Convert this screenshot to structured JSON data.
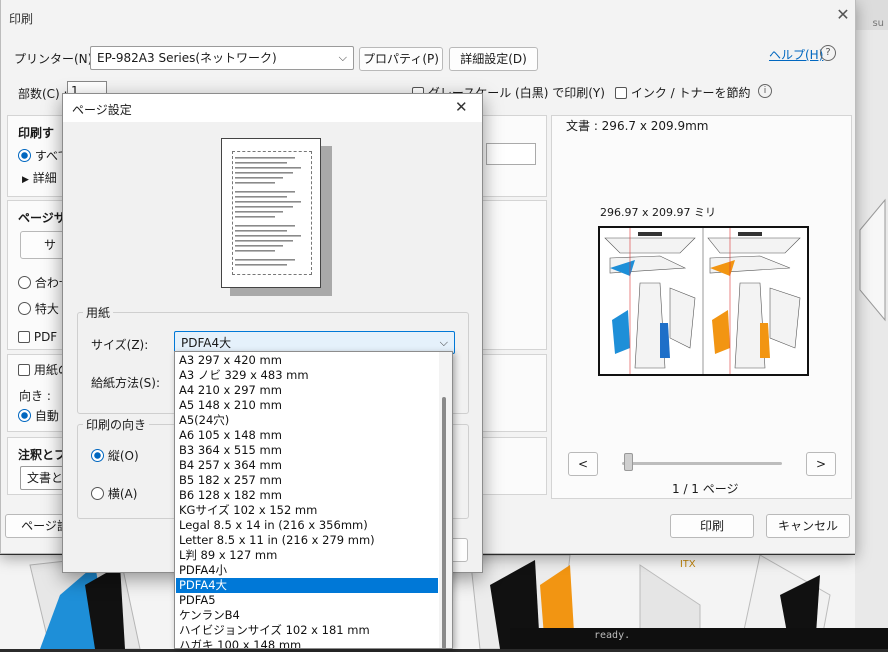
{
  "print": {
    "title": "印刷",
    "printer_label": "プリンター(N) :",
    "printer_value": "EP-982A3 Series(ネットワーク)",
    "properties_btn": "プロパティ(P)",
    "advanced_btn": "詳細設定(D)",
    "help_link": "ヘルプ(H)",
    "copies_label": "部数(C) :",
    "copies_value": "1",
    "grayscale_label": "グレースケール (白黒) で印刷(Y)",
    "ink_save_label": "インク / トナーを節約",
    "print_range_title": "印刷す",
    "all_pages": "すべて",
    "details": "詳細",
    "page_size_title": "ページサ",
    "size_btn": "サ",
    "fit": "合わせ",
    "large": "特大",
    "pdf": "PDF の",
    "paper": "用紙の",
    "orientation": "向き :",
    "auto": "自動",
    "notes_title": "注釈とフ",
    "notes_select": "文書と注",
    "page_setup_btn": "ページ設",
    "doc_size": "文書 : 296.7 x 209.9mm",
    "preview_size": "296.97 x 209.97 ミリ",
    "page_count": "1 / 1 ページ",
    "prev": "<",
    "next": ">",
    "print_btn": "印刷",
    "cancel_btn": "キャンセル"
  },
  "page_setup": {
    "title": "ページ設定",
    "paper_group": "用紙",
    "size_label": "サイズ(Z):",
    "size_value": "PDFA4大",
    "source_label": "給紙方法(S):",
    "orientation_group": "印刷の向き",
    "portrait": "縦(O)",
    "landscape": "横(A)",
    "sizes": [
      "A3 297 x 420 mm",
      "A3 ノビ 329 x 483 mm",
      "A4 210 x 297 mm",
      "A5 148 x 210 mm",
      "A5(24穴)",
      "A6 105 x 148 mm",
      "B3 364 x 515 mm",
      "B4 257 x 364 mm",
      "B5 182 x 257 mm",
      "B6 128 x 182 mm",
      "KGサイズ 102 x 152 mm",
      "Legal 8.5 x 14 in (216 x 356mm)",
      "Letter 8.5 x 11 in (216 x 279 mm)",
      "L判 89 x 127 mm",
      "PDFA4小",
      "PDFA4大",
      "PDFA5",
      "ケンランB4",
      "ハイビジョンサイズ 102 x 181 mm",
      "ハガキ 100 x 148 mm"
    ],
    "selected_index": 15
  },
  "background": {
    "console_text": "ready."
  },
  "colors": {
    "accent": "#0078d7",
    "link": "#0067c0"
  }
}
